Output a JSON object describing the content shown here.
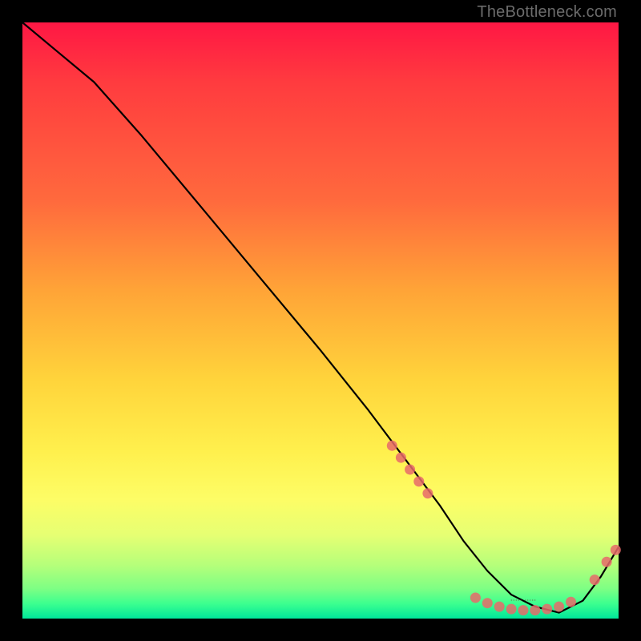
{
  "watermark": "TheBottleneck.com",
  "chart_data": {
    "type": "line",
    "title": "",
    "xlabel": "",
    "ylabel": "",
    "xlim": [
      0,
      100
    ],
    "ylim": [
      0,
      100
    ],
    "grid": false,
    "legend": false,
    "series": [
      {
        "name": "curve",
        "color": "#000000",
        "x": [
          0,
          6,
          12,
          20,
          30,
          40,
          50,
          58,
          64,
          70,
          74,
          78,
          82,
          86,
          90,
          94,
          97,
          100
        ],
        "y": [
          100,
          95,
          90,
          81,
          69,
          57,
          45,
          35,
          27,
          19,
          13,
          8,
          4,
          2,
          1,
          3,
          7,
          12
        ]
      }
    ],
    "markers": [
      {
        "name": "cluster-descent",
        "color": "#e86a6a",
        "points": [
          {
            "x": 62,
            "y": 29
          },
          {
            "x": 63.5,
            "y": 27
          },
          {
            "x": 65,
            "y": 25
          },
          {
            "x": 66.5,
            "y": 23
          },
          {
            "x": 68,
            "y": 21
          }
        ]
      },
      {
        "name": "cluster-trough",
        "color": "#e86a6a",
        "points": [
          {
            "x": 76,
            "y": 3.5
          },
          {
            "x": 78,
            "y": 2.6
          },
          {
            "x": 80,
            "y": 2.0
          },
          {
            "x": 82,
            "y": 1.6
          },
          {
            "x": 84,
            "y": 1.4
          },
          {
            "x": 86,
            "y": 1.4
          },
          {
            "x": 88,
            "y": 1.6
          },
          {
            "x": 90,
            "y": 2.0
          },
          {
            "x": 92,
            "y": 2.8
          }
        ]
      },
      {
        "name": "cluster-rise",
        "color": "#e86a6a",
        "points": [
          {
            "x": 96,
            "y": 6.5
          },
          {
            "x": 98,
            "y": 9.5
          },
          {
            "x": 99.5,
            "y": 11.5
          }
        ]
      }
    ],
    "annotation": {
      "text_small": "····· ·····",
      "x": 84,
      "y": 2.5,
      "color": "#7a2a2a"
    }
  }
}
